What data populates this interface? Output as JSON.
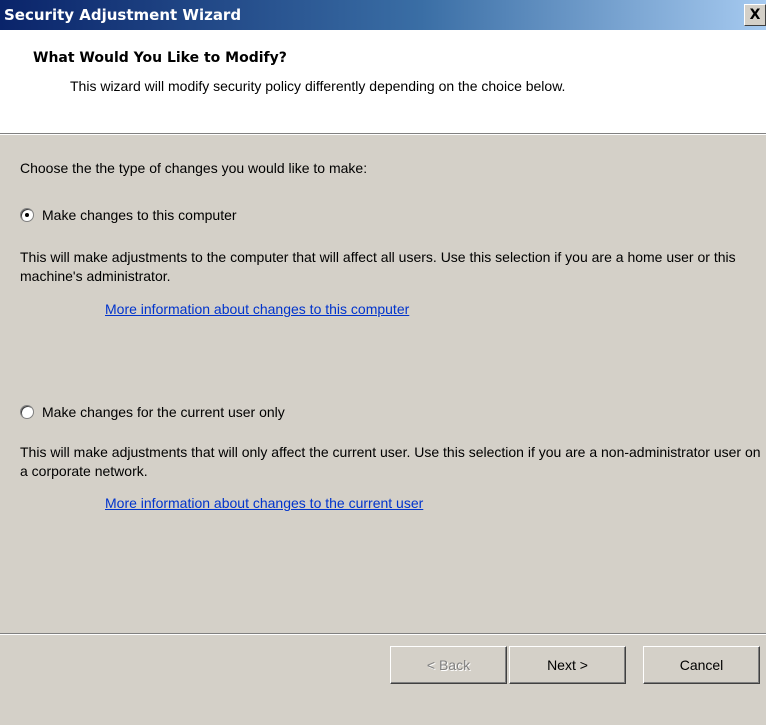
{
  "window": {
    "title": "Security Adjustment Wizard",
    "close_glyph": "X"
  },
  "header": {
    "title": "What Would You Like to Modify?",
    "subtitle": "This wizard will modify security policy differently depending on the choice below."
  },
  "prompt": "Choose the the type of changes you would like to make:",
  "options": [
    {
      "label": "Make changes to this computer",
      "selected": true,
      "description": "This will make adjustments to the computer that will affect all users.  Use this selection if you are a home user or this machine's administrator.",
      "link": "More information about changes to this computer"
    },
    {
      "label": "Make changes for the current user only",
      "selected": false,
      "description": "This will make adjustments that will only affect the current user.  Use this selection if you are a non-administrator user on a corporate network.",
      "link": "More information about changes to the current user"
    }
  ],
  "buttons": {
    "back": "< Back",
    "next": "Next >",
    "cancel": "Cancel"
  }
}
